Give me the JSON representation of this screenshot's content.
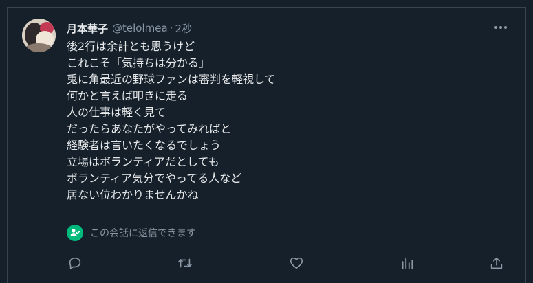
{
  "tweet": {
    "display_name": "月本華子",
    "handle": "@telolmea",
    "separator": "·",
    "time": "2秒",
    "lines": [
      "後2行は余計とも思うけど",
      "これこそ「気持ちは分かる」",
      "兎に角最近の野球ファンは審判を軽視して",
      "何かと言えば叩きに走る",
      "人の仕事は軽く見て",
      "だったらあなたがやってみればと",
      "経験者は言いたくなるでしょう",
      "立場はボランティアだとしても",
      "ボランティア気分でやってる人など",
      "居ない位わかりませんかね"
    ],
    "reply_notice": "この会話に返信できます"
  },
  "theme": {
    "background": "#15202b",
    "text": "#e7e9ea",
    "muted": "#8b98a5",
    "badge": "#00ba7c"
  },
  "icons": [
    "more-icon",
    "reply-icon",
    "retweet-icon",
    "like-icon",
    "views-icon",
    "share-icon",
    "person-check-icon"
  ]
}
